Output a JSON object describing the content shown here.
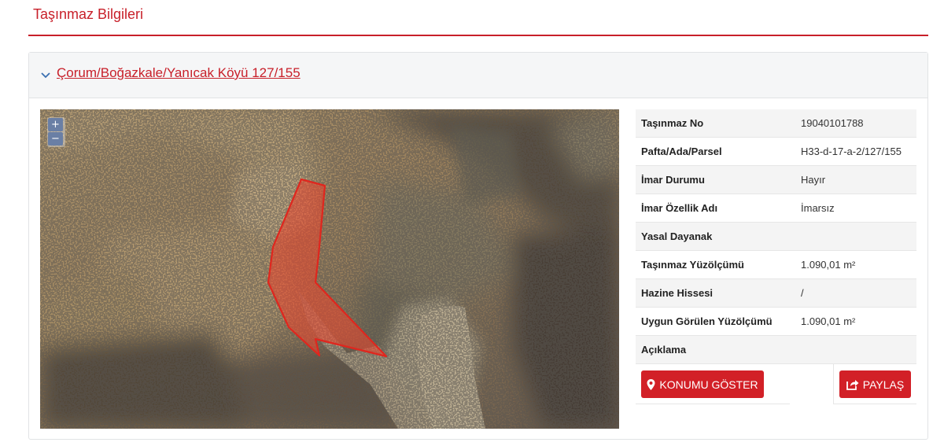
{
  "page": {
    "title": "Taşınmaz Bilgileri"
  },
  "panel": {
    "title": "Çorum/Boğazkale/Yanıcak Köyü 127/155"
  },
  "map": {
    "zoom_in": "+",
    "zoom_out": "−",
    "parcel_color": "#e8472f"
  },
  "info": [
    {
      "label": "Taşınmaz No",
      "value": "19040101788"
    },
    {
      "label": "Pafta/Ada/Parsel",
      "value": "H33-d-17-a-2/127/155"
    },
    {
      "label": "İmar Durumu",
      "value": "Hayır"
    },
    {
      "label": "İmar Özellik Adı",
      "value": "İmarsız"
    },
    {
      "label": "Yasal Dayanak",
      "value": ""
    },
    {
      "label": "Taşınmaz Yüzölçümü",
      "value": "1.090,01 m²"
    },
    {
      "label": "Hazine Hissesi",
      "value": "/"
    },
    {
      "label": "Uygun Görülen Yüzölçümü",
      "value": "1.090,01 m²"
    },
    {
      "label": "Açıklama",
      "value": ""
    }
  ],
  "actions": {
    "show_location": "KONUMU GÖSTER",
    "share": "PAYLAŞ"
  },
  "colors": {
    "accent": "#d22027",
    "title": "#c8202a"
  }
}
